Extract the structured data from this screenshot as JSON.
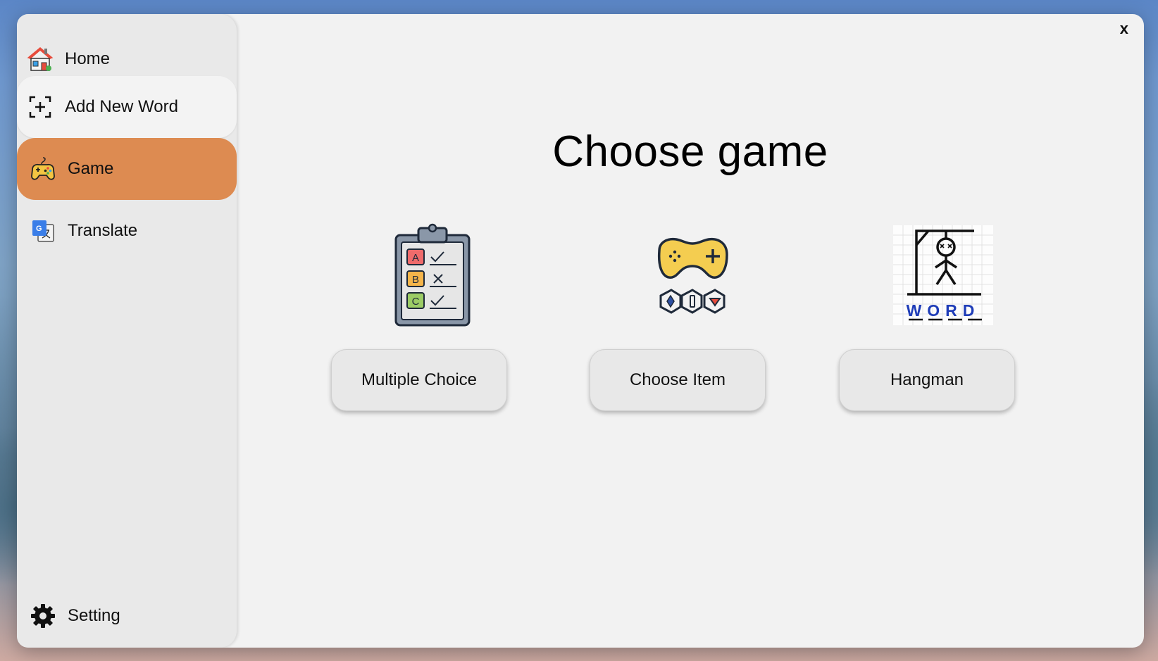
{
  "window": {
    "close_label": "x"
  },
  "sidebar": {
    "items": [
      {
        "label": "Home",
        "icon": "house-icon"
      },
      {
        "label": "Add New Word",
        "icon": "add-square-icon"
      },
      {
        "label": "Game",
        "icon": "gamepad-icon",
        "active": true
      },
      {
        "label": "Translate",
        "icon": "translate-icon"
      },
      {
        "label": "Setting",
        "icon": "gear-icon"
      }
    ]
  },
  "main": {
    "title": "Choose game",
    "games": [
      {
        "label": "Multiple Choice",
        "icon": "clipboard-checklist-icon",
        "icon_text": [
          "A",
          "B",
          "C"
        ]
      },
      {
        "label": "Choose Item",
        "icon": "game-controller-icon"
      },
      {
        "label": "Hangman",
        "icon": "hangman-icon",
        "icon_text": "WORD"
      }
    ]
  },
  "colors": {
    "accent": "#dd8b51",
    "window_bg": "#f2f2f2",
    "sidebar_bg": "#e9e9e9",
    "button_bg": "#e8e8e8"
  }
}
